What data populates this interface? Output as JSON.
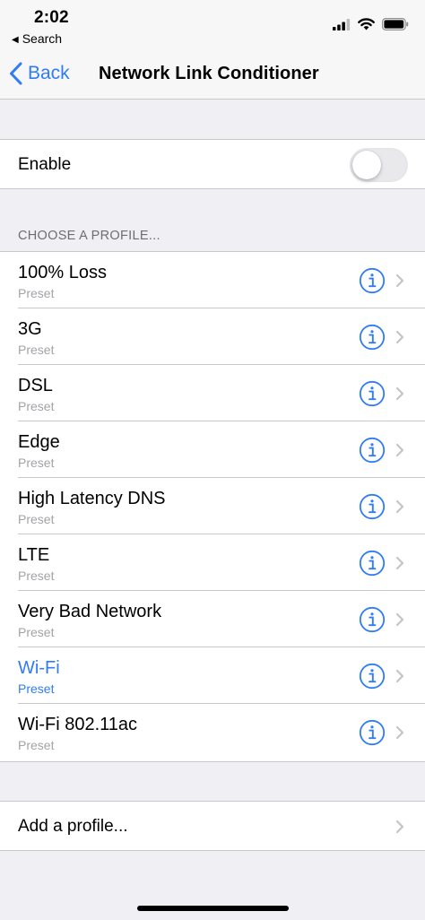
{
  "status_bar": {
    "time": "2:02",
    "back_app_label": "Search"
  },
  "nav": {
    "back_label": "Back",
    "title": "Network Link Conditioner"
  },
  "enable": {
    "label": "Enable",
    "enabled": false
  },
  "profiles": {
    "header": "CHOOSE A PROFILE...",
    "items": [
      {
        "title": "100% Loss",
        "subtitle": "Preset",
        "selected": false
      },
      {
        "title": "3G",
        "subtitle": "Preset",
        "selected": false
      },
      {
        "title": "DSL",
        "subtitle": "Preset",
        "selected": false
      },
      {
        "title": "Edge",
        "subtitle": "Preset",
        "selected": false
      },
      {
        "title": "High Latency DNS",
        "subtitle": "Preset",
        "selected": false
      },
      {
        "title": "LTE",
        "subtitle": "Preset",
        "selected": false
      },
      {
        "title": "Very Bad Network",
        "subtitle": "Preset",
        "selected": false
      },
      {
        "title": "Wi-Fi",
        "subtitle": "Preset",
        "selected": true
      },
      {
        "title": "Wi-Fi 802.11ac",
        "subtitle": "Preset",
        "selected": false
      }
    ]
  },
  "add_profile": {
    "label": "Add a profile..."
  },
  "colors": {
    "accent": "#2f7cf6",
    "background": "#efeff4",
    "separator": "#c8c7cc",
    "secondary_text": "#a3a3a8"
  },
  "icons": {
    "signal": "cellular-signal-icon",
    "wifi": "wifi-icon",
    "battery": "battery-icon",
    "info": "info-circle-icon",
    "chevron": "chevron-right-icon"
  }
}
